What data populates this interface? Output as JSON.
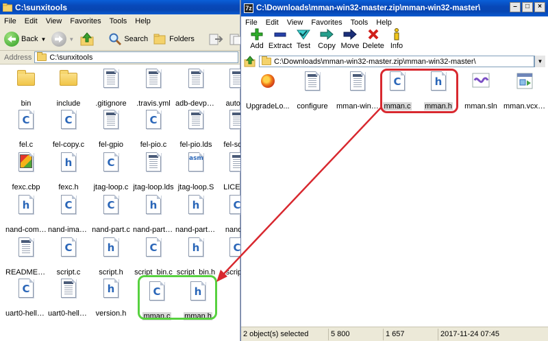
{
  "left": {
    "title": "C:\\sunxitools",
    "menu": [
      "File",
      "Edit",
      "View",
      "Favorites",
      "Tools",
      "Help"
    ],
    "toolbar": {
      "back": "Back",
      "search": "Search",
      "folders": "Folders"
    },
    "address_label": "Address",
    "address": "C:\\sunxitools",
    "files": [
      {
        "name": "bin",
        "icon": "folder"
      },
      {
        "name": "include",
        "icon": "folder"
      },
      {
        "name": ".gitignore",
        "icon": "text"
      },
      {
        "name": ".travis.yml",
        "icon": "text"
      },
      {
        "name": "adb-devpro...",
        "icon": "text"
      },
      {
        "name": "autove",
        "icon": "text"
      },
      {
        "name": "fel.c",
        "icon": "c"
      },
      {
        "name": "fel-copy.c",
        "icon": "c"
      },
      {
        "name": "fel-gpio",
        "icon": "text"
      },
      {
        "name": "fel-pio.c",
        "icon": "c"
      },
      {
        "name": "fel-pio.lds",
        "icon": "text"
      },
      {
        "name": "fel-sdbo",
        "icon": "text"
      },
      {
        "name": "fexc.cbp",
        "icon": "cbp"
      },
      {
        "name": "fexc.h",
        "icon": "h"
      },
      {
        "name": "jtag-loop.c",
        "icon": "c"
      },
      {
        "name": "jtag-loop.lds",
        "icon": "text"
      },
      {
        "name": "jtag-loop.S",
        "icon": "asm"
      },
      {
        "name": "LICENS",
        "icon": "text"
      },
      {
        "name": "nand-comm...",
        "icon": "h"
      },
      {
        "name": "nand-imag...",
        "icon": "c"
      },
      {
        "name": "nand-part.c",
        "icon": "c"
      },
      {
        "name": "nand-part-a...",
        "icon": "h"
      },
      {
        "name": "nand-part-a...",
        "icon": "h"
      },
      {
        "name": "nand-p",
        "icon": "c"
      },
      {
        "name": "README.md",
        "icon": "text"
      },
      {
        "name": "script.c",
        "icon": "c"
      },
      {
        "name": "script.h",
        "icon": "h"
      },
      {
        "name": "script_bin.c",
        "icon": "c"
      },
      {
        "name": "script_bin.h",
        "icon": "h"
      },
      {
        "name": "script_",
        "icon": "c"
      },
      {
        "name": "uart0-hello...",
        "icon": "c"
      },
      {
        "name": "uart0-hello...",
        "icon": "text"
      },
      {
        "name": "version.h",
        "icon": "h"
      },
      {
        "name": "mman.c",
        "icon": "c",
        "selected": true
      },
      {
        "name": "mman.h",
        "icon": "h",
        "selected": true
      }
    ]
  },
  "right": {
    "title": "C:\\Downloads\\mman-win32-master.zip\\mman-win32-master\\",
    "menu": [
      "File",
      "Edit",
      "View",
      "Favorites",
      "Tools",
      "Help"
    ],
    "toolbar": [
      "Add",
      "Extract",
      "Test",
      "Copy",
      "Move",
      "Delete",
      "Info"
    ],
    "address": "C:\\Downloads\\mman-win32-master.zip\\mman-win32-master\\",
    "files": [
      {
        "name": "UpgradeLo...",
        "icon": "firefox"
      },
      {
        "name": "configure",
        "icon": "text"
      },
      {
        "name": "mman-win3...",
        "icon": "text"
      },
      {
        "name": "mman.c",
        "icon": "c",
        "selected": true
      },
      {
        "name": "mman.h",
        "icon": "h",
        "selected": true
      },
      {
        "name": "mman.sln",
        "icon": "sln"
      },
      {
        "name": "mman.vcxproj",
        "icon": "vcx"
      }
    ],
    "status": [
      "2 object(s) selected",
      "5 800",
      "1 657",
      "2017-11-24 07:45"
    ]
  },
  "icon_labels": {
    "c": "C",
    "h": "h",
    "asm": "asm"
  },
  "colors": {
    "green_highlight": "#57d13f",
    "red_highlight": "#d8282f",
    "title_blue": "#0848b8"
  }
}
